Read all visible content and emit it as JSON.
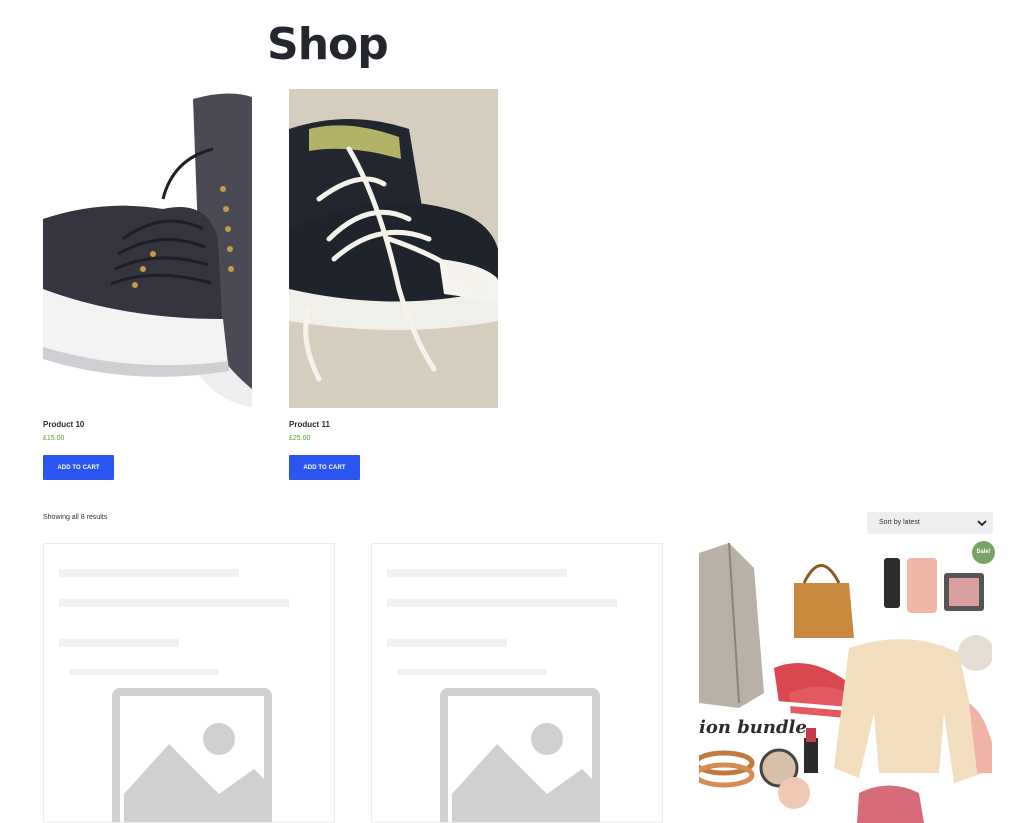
{
  "page": {
    "title": "Shop"
  },
  "featured_products": [
    {
      "name": "Product 10",
      "price": "£15.00",
      "button_label": "ADD TO CART"
    },
    {
      "name": "Product 11",
      "price": "£25.00",
      "button_label": "ADD TO CART"
    }
  ],
  "shop": {
    "result_count": "Showing all 8 results",
    "sort": {
      "selected": "Sort by latest"
    },
    "sale_badge": "Sale!",
    "collage_text": "ion bundle"
  },
  "colors": {
    "title": "#23262d",
    "button": "#2a55f0",
    "price": "#5a9e3a",
    "sale_badge": "#77a464",
    "placeholder": "#cfd0d2"
  },
  "icons": [
    "sneaker-photo",
    "chevron-down-icon",
    "placeholder-image-icon"
  ]
}
